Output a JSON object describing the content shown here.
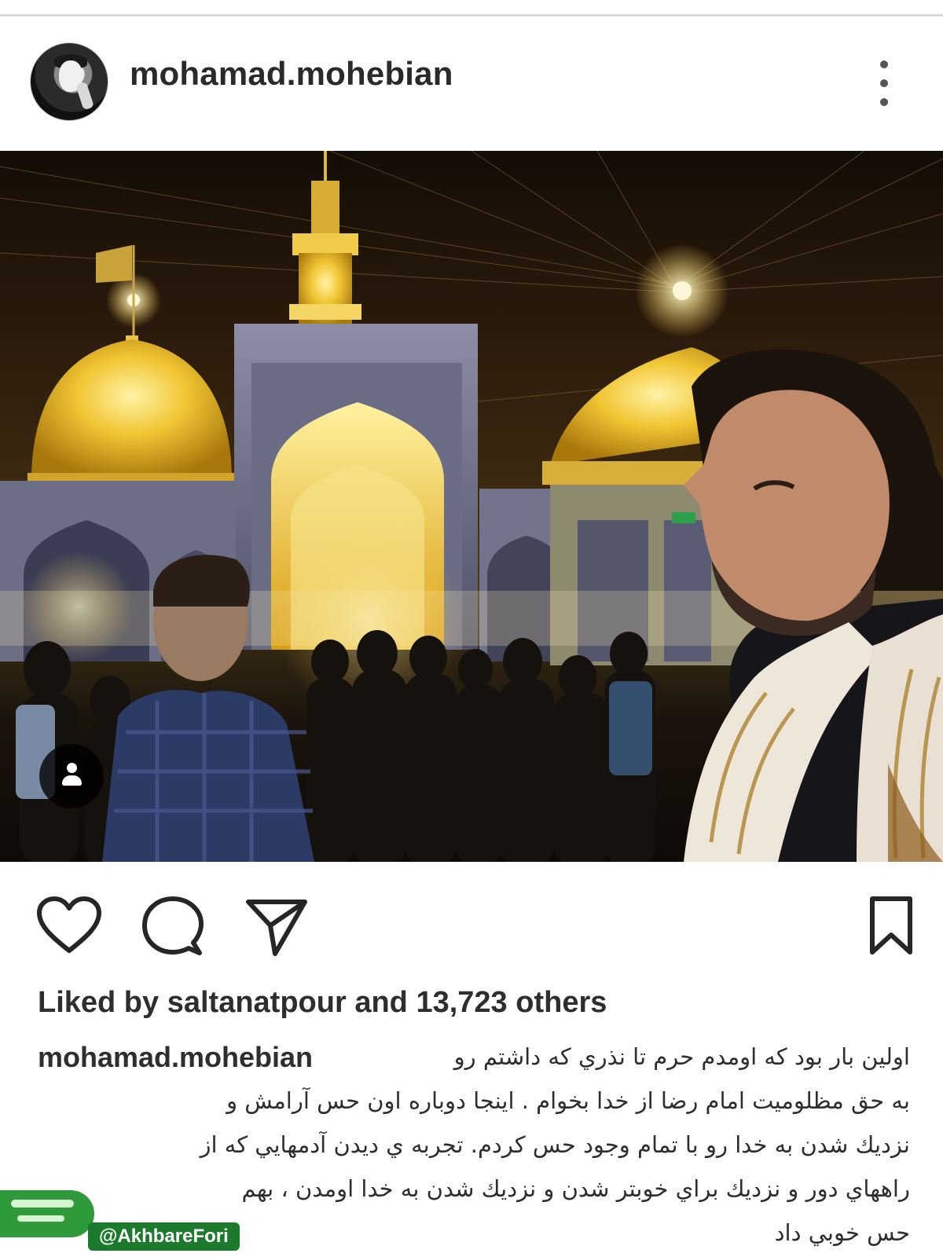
{
  "post": {
    "username": "mohamad.mohebian",
    "likes": {
      "prefix": "Liked by",
      "liker": "saltanatpour",
      "connector": "and",
      "count": "13,723 others"
    },
    "caption": {
      "author": "mohamad.mohebian",
      "lines": [
        "اولین بار بود که اومدم حرم تا نذري که داشتم رو",
        "به حق مظلوميت امام رضا از خدا بخوام . اينجا دوباره اون حس آرامش و",
        "نزديك شدن به خدا رو با تمام وجود حس كردم. تجربه ي ديدن آدمهايي كه از",
        "راههاي دور و نزديك براي خوبتر شدن و نزديك شدن به خدا اومدن ، بهم",
        "حس خوبي داد"
      ]
    }
  },
  "icons": {
    "more": "more-vertical-icon",
    "tag": "user-tag-icon",
    "like": "heart-icon",
    "comment": "comment-icon",
    "share": "send-icon",
    "save": "bookmark-icon"
  },
  "watermark": {
    "handle": "@AkhbareFori",
    "color": "#1b7a2c"
  }
}
